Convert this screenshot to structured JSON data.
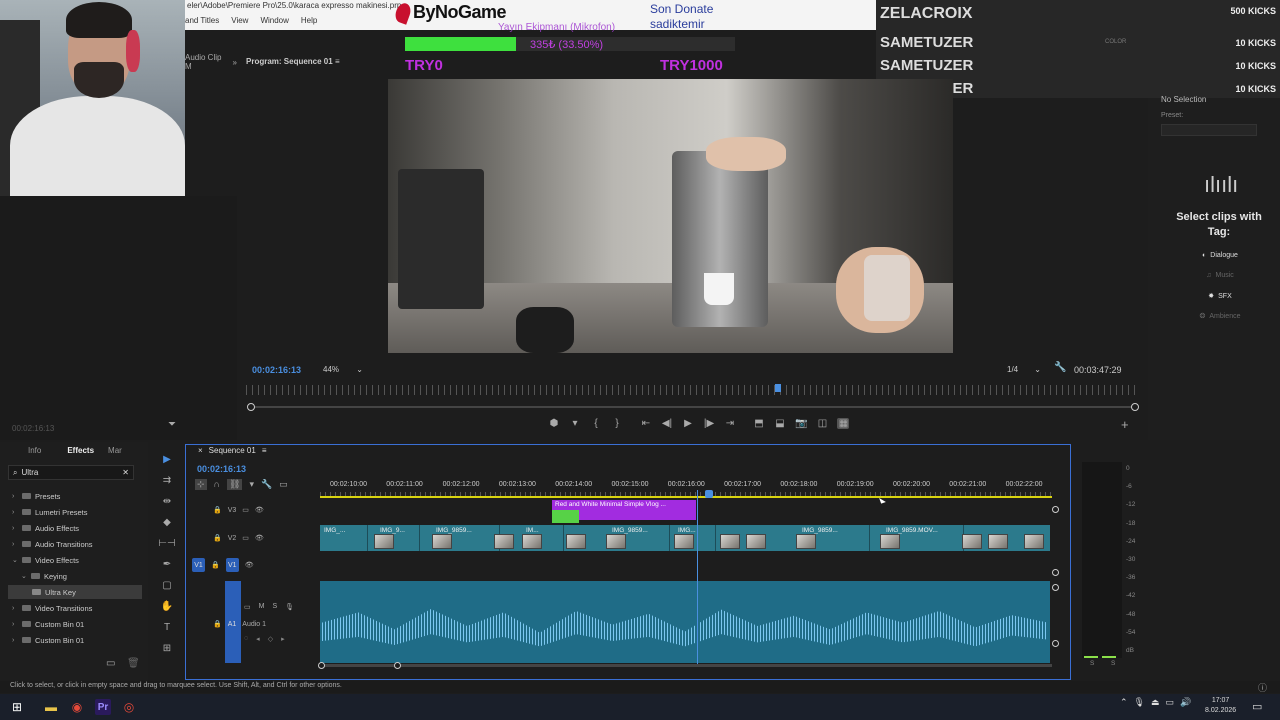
{
  "titlebar": {
    "path": "eler\\Adobe\\Premiere Pro\\25.0\\karaca expresso makinesi.prp",
    "menu": [
      "and Titles",
      "View",
      "Window",
      "Help"
    ]
  },
  "overlay": {
    "brand": "ByNoGame",
    "donate_label": "Son Donate",
    "donate_user": "sadiktemir",
    "mic_label": "Yayın Ekipmanı (Mikrofon)",
    "progress_text": "335₺ (33.50%)",
    "progress_fraction": 0.335,
    "try_start": "TRY0",
    "try_end": "TRY1000",
    "accent_color": "#c030e0"
  },
  "kicks": {
    "top_count": "500 KICKS",
    "rows": [
      {
        "name": "ZELACROIX",
        "count": "500 KICKS"
      },
      {
        "name": "SAMETUZER",
        "count": "10 KICKS"
      },
      {
        "name": "SAMETUZER",
        "count": "10 KICKS"
      },
      {
        "name": "SAMETUZER",
        "count": "10 KICKS"
      }
    ],
    "bg_hint": "COLOR"
  },
  "audio_clip_panel": {
    "label": "Audio Clip M"
  },
  "program": {
    "title": "Program: Sequence 01",
    "timecode": "00:02:16:13",
    "zoom": "44%",
    "resolution": "1/4",
    "duration": "00:03:47:29"
  },
  "left_panel": {
    "timecode": "00:02:16:13"
  },
  "essential_sound": {
    "no_selection": "No Selection",
    "preset_label": "Preset:",
    "prompt": "Select clips with Tag:",
    "tags": [
      "Dialogue",
      "Music",
      "SFX",
      "Ambience"
    ]
  },
  "effects": {
    "tabs": [
      "Info",
      "Effects",
      "Mar"
    ],
    "search_value": "Ultra",
    "tree": [
      {
        "label": "Presets",
        "level": 0,
        "expanded": false
      },
      {
        "label": "Lumetri Presets",
        "level": 0,
        "expanded": false
      },
      {
        "label": "Audio Effects",
        "level": 0,
        "expanded": false
      },
      {
        "label": "Audio Transitions",
        "level": 0,
        "expanded": false
      },
      {
        "label": "Video Effects",
        "level": 0,
        "expanded": true
      },
      {
        "label": "Keying",
        "level": 1,
        "expanded": true
      },
      {
        "label": "Ultra Key",
        "level": 2,
        "expanded": false
      },
      {
        "label": "Video Transitions",
        "level": 0,
        "expanded": false
      },
      {
        "label": "Custom Bin 01",
        "level": 0,
        "expanded": false
      },
      {
        "label": "Custom Bin 01",
        "level": 0,
        "expanded": false
      }
    ]
  },
  "timeline": {
    "sequence_tab": "Sequence 01",
    "timecode": "00:02:16:13",
    "ruler_ticks": [
      "00:02:10:00",
      "00:02:11:00",
      "00:02:12:00",
      "00:02:13:00",
      "00:02:14:00",
      "00:02:15:00",
      "00:02:16:00",
      "00:02:17:00",
      "00:02:18:00",
      "00:02:19:00",
      "00:02:20:00",
      "00:02:21:00",
      "00:02:22:00"
    ],
    "tracks": {
      "v3": "V3",
      "v2": "V2",
      "v1": "V1",
      "a1": "A1",
      "a1_name": "Audio 1"
    },
    "v3_clip": "Red and White Minimal Simple Vlog ...",
    "v2_clips": [
      "IMG_...",
      "IMG_9...",
      "IMG_9859...",
      "IM...",
      "IMG_9859...",
      "IMG...",
      "IMG_9859...",
      "IMG_9859.MOV..."
    ]
  },
  "meter_labels": [
    "0",
    "-6",
    "-12",
    "-18",
    "-24",
    "-30",
    "-36",
    "-42",
    "-48",
    "-54",
    "dB"
  ],
  "meter_channels": [
    "S",
    "S"
  ],
  "status": "Click to select, or click in empty space and drag to marquee select. Use Shift, Alt, and Ctrl for other options.",
  "clock": {
    "time": "17:07",
    "date": "8.02.2026"
  }
}
